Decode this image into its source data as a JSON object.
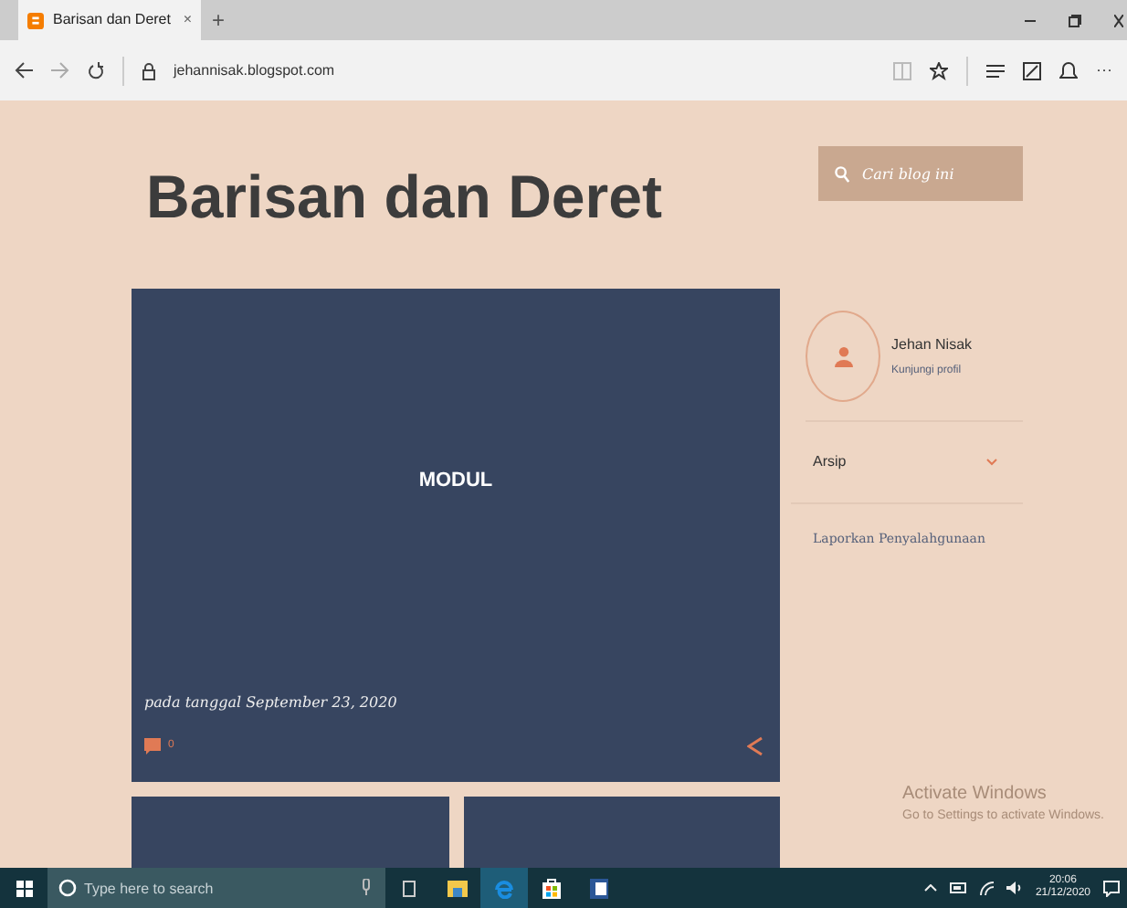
{
  "browser": {
    "tab_title": "Barisan dan Deret",
    "tab_close": "×",
    "new_tab": "+",
    "url": "jehannisak.blogspot.com",
    "more": "···"
  },
  "blog": {
    "title": "Barisan dan Deret",
    "search": {
      "placeholder": "Cari blog ini"
    },
    "post": {
      "title": "MODUL",
      "date": "pada tanggal September 23, 2020",
      "comments": "0"
    },
    "profile": {
      "name": "Jehan Nisak",
      "link": "Kunjungi profil"
    },
    "archive": {
      "label": "Arsip"
    },
    "report": "Laporkan Penyalahgunaan"
  },
  "activation": {
    "title": "Activate Windows",
    "subtitle": "Go to Settings to activate Windows."
  },
  "taskbar": {
    "search": {
      "placeholder": "Type here to search"
    },
    "time": "20:06",
    "date": "21/12/2020"
  }
}
